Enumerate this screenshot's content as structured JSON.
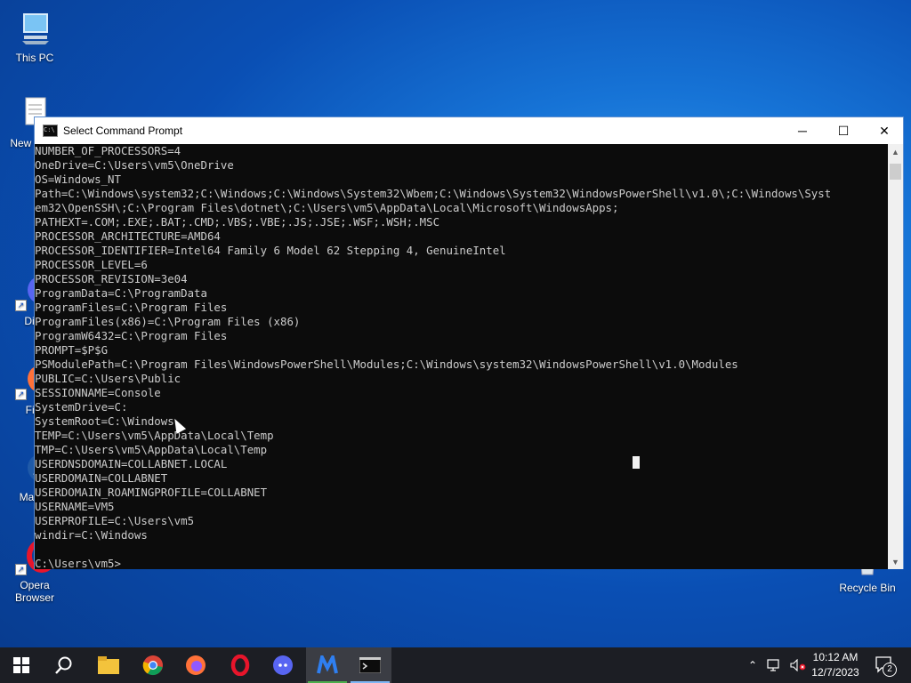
{
  "desktop": {
    "icons": [
      {
        "label": "This PC"
      },
      {
        "label": "New Docu"
      },
      {
        "label": "Disc"
      },
      {
        "label": "Fire"
      },
      {
        "label": "Malwa"
      },
      {
        "label": "Opera Browser"
      },
      {
        "label": "Recycle Bin"
      }
    ]
  },
  "window": {
    "title": "Select Command Prompt",
    "controls": {
      "minimize": "─",
      "maximize": "☐",
      "close": "✕"
    },
    "lines": [
      "NUMBER_OF_PROCESSORS=4",
      "OneDrive=C:\\Users\\vm5\\OneDrive",
      "OS=Windows_NT",
      "Path=C:\\Windows\\system32;C:\\Windows;C:\\Windows\\System32\\Wbem;C:\\Windows\\System32\\WindowsPowerShell\\v1.0\\;C:\\Windows\\Syst",
      "em32\\OpenSSH\\;C:\\Program Files\\dotnet\\;C:\\Users\\vm5\\AppData\\Local\\Microsoft\\WindowsApps;",
      "PATHEXT=.COM;.EXE;.BAT;.CMD;.VBS;.VBE;.JS;.JSE;.WSF;.WSH;.MSC",
      "PROCESSOR_ARCHITECTURE=AMD64",
      "PROCESSOR_IDENTIFIER=Intel64 Family 6 Model 62 Stepping 4, GenuineIntel",
      "PROCESSOR_LEVEL=6",
      "PROCESSOR_REVISION=3e04",
      "ProgramData=C:\\ProgramData",
      "ProgramFiles=C:\\Program Files",
      "ProgramFiles(x86)=C:\\Program Files (x86)",
      "ProgramW6432=C:\\Program Files",
      "PROMPT=$P$G",
      "PSModulePath=C:\\Program Files\\WindowsPowerShell\\Modules;C:\\Windows\\system32\\WindowsPowerShell\\v1.0\\Modules",
      "PUBLIC=C:\\Users\\Public",
      "SESSIONNAME=Console",
      "SystemDrive=C:",
      "SystemRoot=C:\\Windows",
      "TEMP=C:\\Users\\vm5\\AppData\\Local\\Temp",
      "TMP=C:\\Users\\vm5\\AppData\\Local\\Temp",
      "USERDNSDOMAIN=COLLABNET.LOCAL",
      "USERDOMAIN=COLLABNET",
      "USERDOMAIN_ROAMINGPROFILE=COLLABNET",
      "USERNAME=VM5",
      "USERPROFILE=C:\\Users\\vm5",
      "windir=C:\\Windows",
      "",
      "C:\\Users\\vm5>"
    ]
  },
  "taskbar": {
    "start_icon": "windows-logo-icon",
    "search_icon": "search-icon",
    "apps": [
      {
        "name": "file-explorer-icon"
      },
      {
        "name": "chrome-icon"
      },
      {
        "name": "firefox-icon"
      },
      {
        "name": "opera-icon"
      },
      {
        "name": "discord-icon"
      },
      {
        "name": "malwarebytes-icon"
      },
      {
        "name": "command-prompt-icon"
      }
    ],
    "time": "10:12 AM",
    "date": "12/7/2023",
    "notification_count": "2"
  }
}
